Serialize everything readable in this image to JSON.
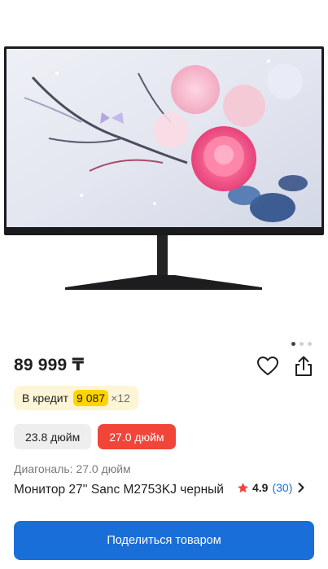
{
  "product": {
    "image_alt": "Монитор с изображением розовых цветов",
    "price": "89 999 ₸",
    "credit": {
      "label": "В кредит",
      "amount": "9 087",
      "term": "×12"
    },
    "variants": [
      {
        "label": "23.8 дюйм",
        "selected": false
      },
      {
        "label": "27.0 дюйм",
        "selected": true
      }
    ],
    "spec": "Диагональ: 27.0 дюйм",
    "title": "Монитор 27'' Sanc M2753KJ черный",
    "rating": {
      "value": "4.9",
      "count": "(30)"
    },
    "gallery": {
      "total": 3,
      "active": 1
    }
  },
  "actions": {
    "share_button": "Поделиться товаром"
  },
  "icons": {
    "favorite": "heart-icon",
    "share": "share-icon",
    "star": "star-icon",
    "chevron": "chevron-right-icon"
  },
  "colors": {
    "accent": "#1a6ed8",
    "selected_variant": "#f2453a",
    "credit_bg": "#fdf5d6",
    "credit_highlight": "#ffd400",
    "star": "#f2453a"
  }
}
